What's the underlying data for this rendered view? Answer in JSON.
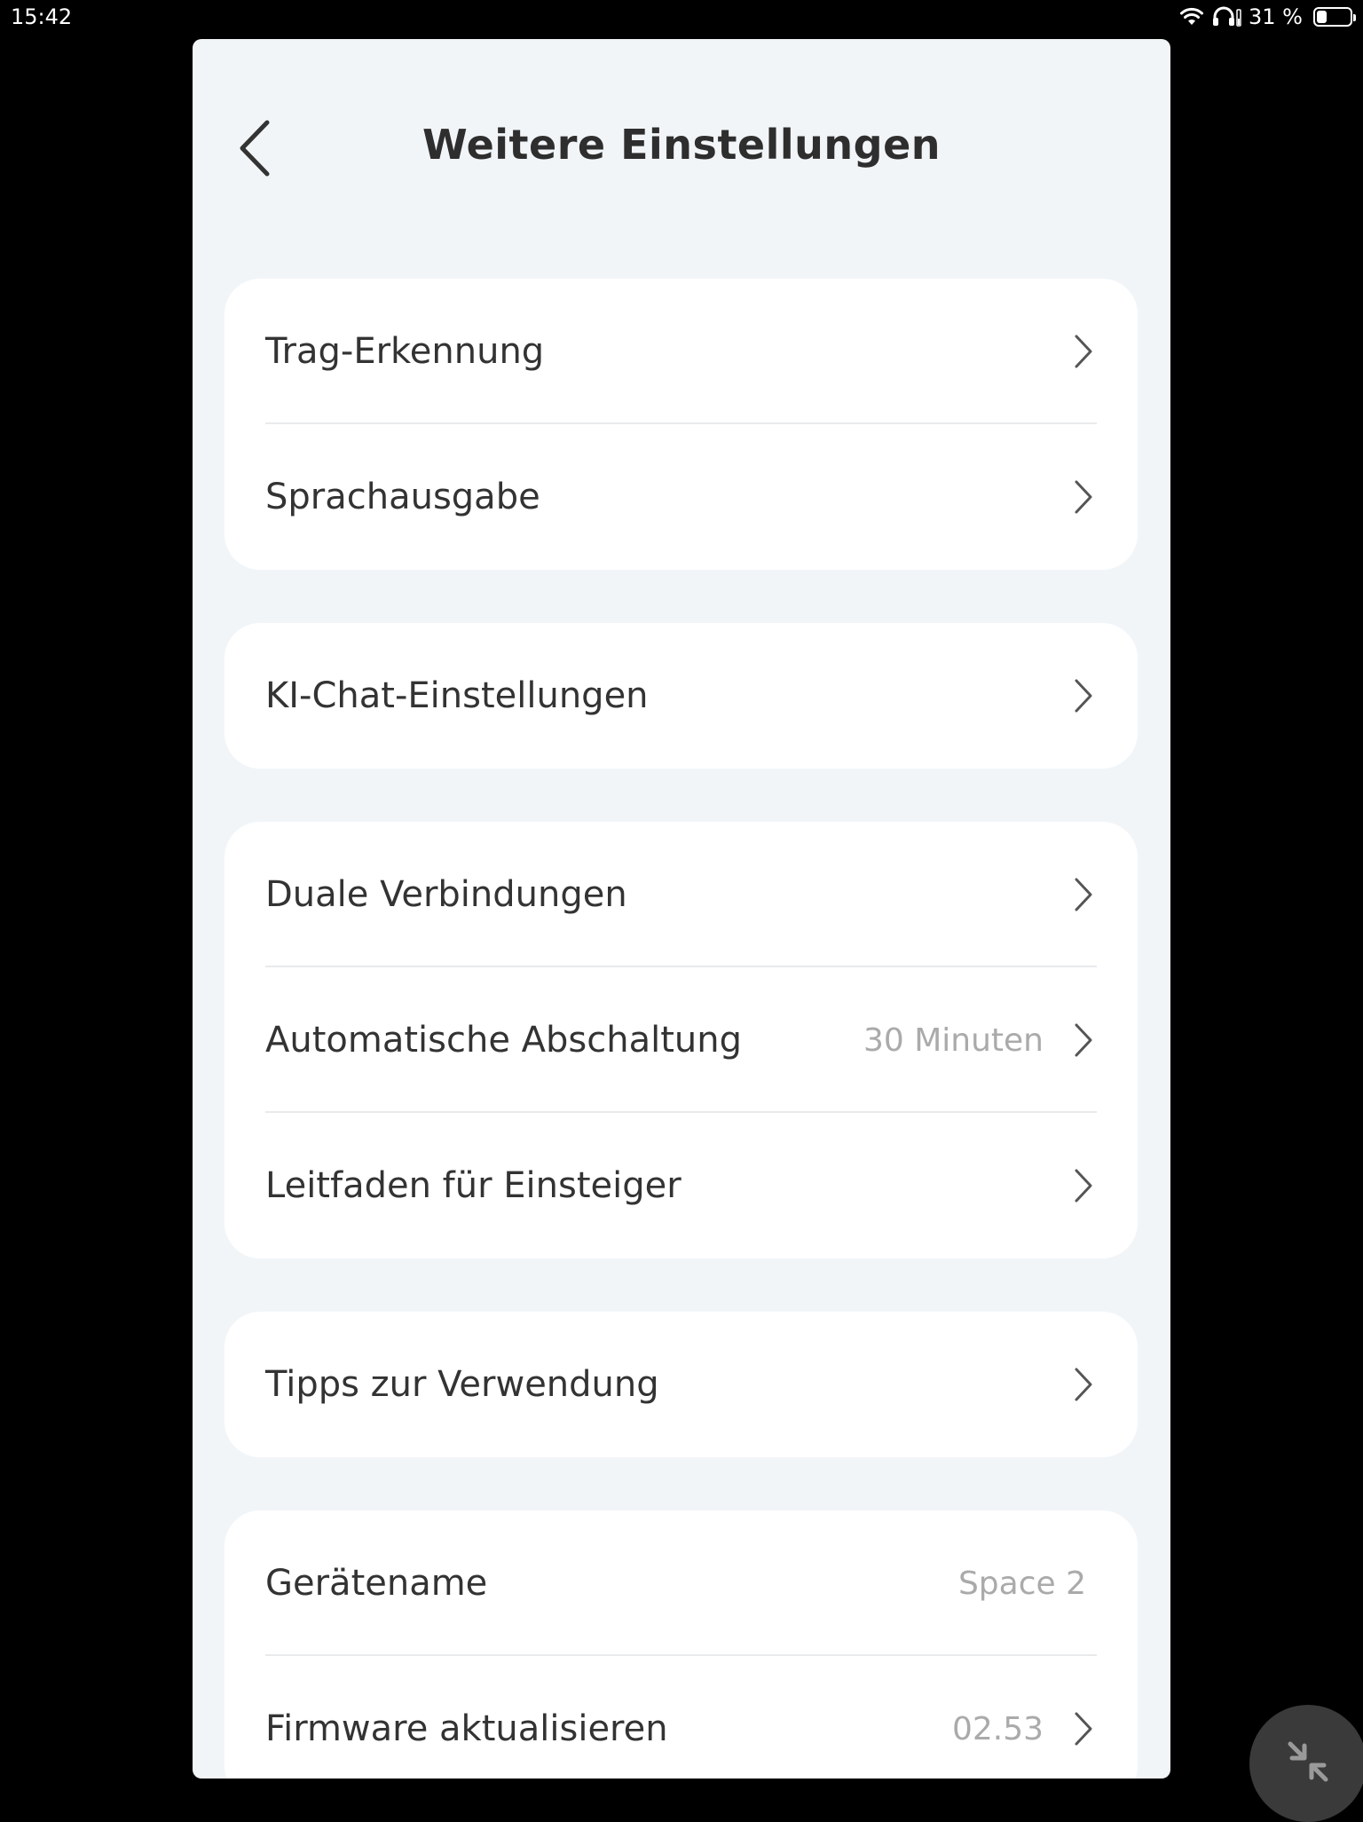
{
  "status_bar": {
    "time": "15:42",
    "battery_percent_label": "31 %",
    "battery_level": 0.31,
    "icons": [
      "wifi-icon",
      "headphones-icon",
      "battery-icon"
    ]
  },
  "header": {
    "title": "Weitere Einstellungen",
    "back_icon": "chevron-left-icon"
  },
  "groups": [
    {
      "items": [
        {
          "label": "Trag-Erkennung",
          "value": "",
          "chevron": true
        },
        {
          "label": "Sprachausgabe",
          "value": "",
          "chevron": true
        }
      ]
    },
    {
      "items": [
        {
          "label": "KI-Chat-Einstellungen",
          "value": "",
          "chevron": true
        }
      ]
    },
    {
      "items": [
        {
          "label": "Duale Verbindungen",
          "value": "",
          "chevron": true
        },
        {
          "label": "Automatische Abschaltung",
          "value": "30 Minuten",
          "chevron": true
        },
        {
          "label": "Leitfaden für Einsteiger",
          "value": "",
          "chevron": true
        }
      ]
    },
    {
      "items": [
        {
          "label": "Tipps zur Verwendung",
          "value": "",
          "chevron": true
        }
      ]
    },
    {
      "items": [
        {
          "label": "Gerätename",
          "value": "Space 2",
          "chevron": false
        },
        {
          "label": "Firmware aktualisieren",
          "value": "02.53",
          "chevron": true
        }
      ]
    }
  ],
  "floating_button": {
    "icon": "minimize-arrows-icon"
  },
  "colors": {
    "background": "#000000",
    "window": "#f2f5f8",
    "card": "#ffffff",
    "text_primary": "#333333",
    "text_secondary": "#aaaaaa",
    "divider": "#e8eaec",
    "fab": "#3a3a3a"
  }
}
